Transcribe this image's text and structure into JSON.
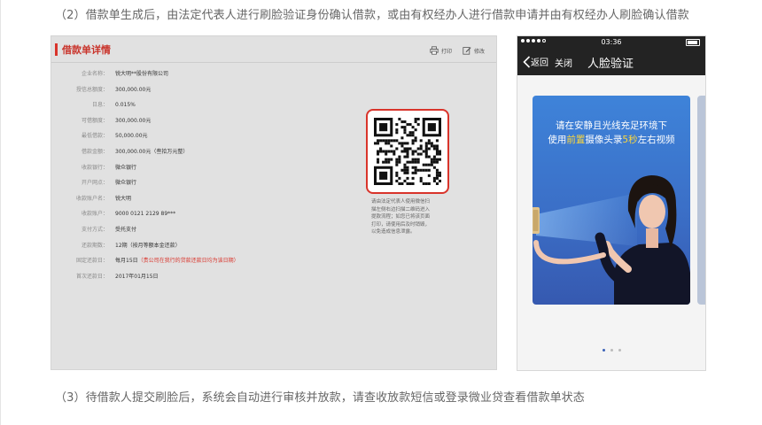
{
  "para_top": "（2）借款单生成后，由法定代表人进行刷脸验证身份确认借款，或由有权经办人进行借款申请并由有权经办人刷脸确认借款",
  "para_bottom": "（3）待借款人提交刷脸后，系统会自动进行审核并放款，请查收放款短信或登录微业贷查看借款单状态",
  "loan": {
    "title": "借款单详情",
    "print_label": "打印",
    "edit_label": "修改",
    "rows": [
      {
        "label": "企业名称：",
        "value": "锐大明**股份有限公司"
      },
      {
        "label": "授信总额度：",
        "value": "300,000.00元"
      },
      {
        "label": "日息：",
        "value": "0.015%"
      },
      {
        "label": "可借额度：",
        "value": "300,000.00元"
      },
      {
        "label": "最低借款：",
        "value": "50,000.00元"
      },
      {
        "label": "借款金额：",
        "value": "300,000.00元（叁拾万元整）"
      },
      {
        "label": "收款银行：",
        "value": "微众银行"
      },
      {
        "label": "开户网点：",
        "value": "微众银行"
      },
      {
        "label": "收款账户名：",
        "value": "锐大明"
      },
      {
        "label": "收款账户：",
        "value": "9000 0121 2129 89***"
      },
      {
        "label": "支付方式：",
        "value": "受托支付"
      },
      {
        "label": "还款期数：",
        "value": "12期（按月等额本金还款）"
      },
      {
        "label": "固定还款日：",
        "value": "每月15日",
        "note": "（贵公司在我行的贷款还款日均为该日期）"
      },
      {
        "label": "首次还款日：",
        "value": "2017年01月15日"
      }
    ],
    "qr_caption": [
      "请由法定代表人使用微信扫",
      "描左侧右边扫描二维码进入",
      "提款流程；如您已将该页面",
      "打印，请使用后及时销毁，",
      "以免造成信息泄露。"
    ]
  },
  "phone": {
    "status_time": "03:36",
    "back_label": "返回",
    "close_label": "关闭",
    "nav_title": "人脸验证",
    "card_line1": "请在安静且光线充足环境下",
    "card_line2_pre": "使用",
    "card_line2_hl1": "前置",
    "card_line2_mid": "摄像头录",
    "card_line2_hl2": "5秒",
    "card_line2_post": "左右视频",
    "dots_total": 3,
    "dots_active": 1
  },
  "colors": {
    "accent_red": "#d9342b",
    "card_blue": "#3b6fc7",
    "highlight_yellow": "#ffd83a"
  }
}
